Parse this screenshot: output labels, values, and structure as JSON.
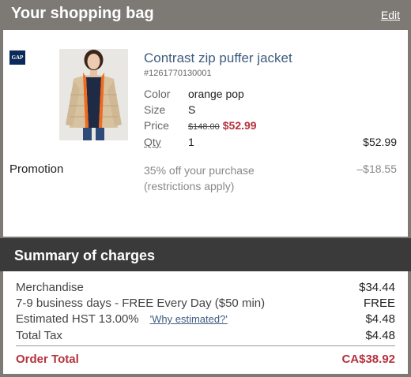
{
  "bag": {
    "title": "Your shopping bag",
    "edit_label": "Edit",
    "brand_logo": "GAP",
    "item": {
      "name": "Contrast zip puffer jacket",
      "sku": "#1261770130001",
      "color_label": "Color",
      "color_value": "orange pop",
      "size_label": "Size",
      "size_value": "S",
      "price_label": "Price",
      "original_price": "$148.00",
      "sale_price": "$52.99",
      "qty_label": "Qty",
      "qty_value": "1",
      "line_total": "$52.99"
    },
    "promotion": {
      "label": "Promotion",
      "description": "35% off your purchase (restrictions apply)",
      "amount": "–$18.55"
    }
  },
  "summary": {
    "title": "Summary of charges",
    "merchandise_label": "Merchandise",
    "merchandise_value": "$34.44",
    "shipping_label": "7-9 business days - FREE Every Day ($50 min)",
    "shipping_value": "FREE",
    "hst_label": "Estimated HST 13.00%",
    "why_link": "'Why estimated?'",
    "hst_value": "$4.48",
    "total_tax_label": "Total Tax",
    "total_tax_value": "$4.48",
    "order_total_label": "Order Total",
    "order_total_value": "CA$38.92"
  },
  "colors": {
    "header_bg": "#7d7a75",
    "summary_header_bg": "#3a3a3a",
    "accent_red": "#b5323c",
    "link_blue": "#3f5c7f"
  }
}
